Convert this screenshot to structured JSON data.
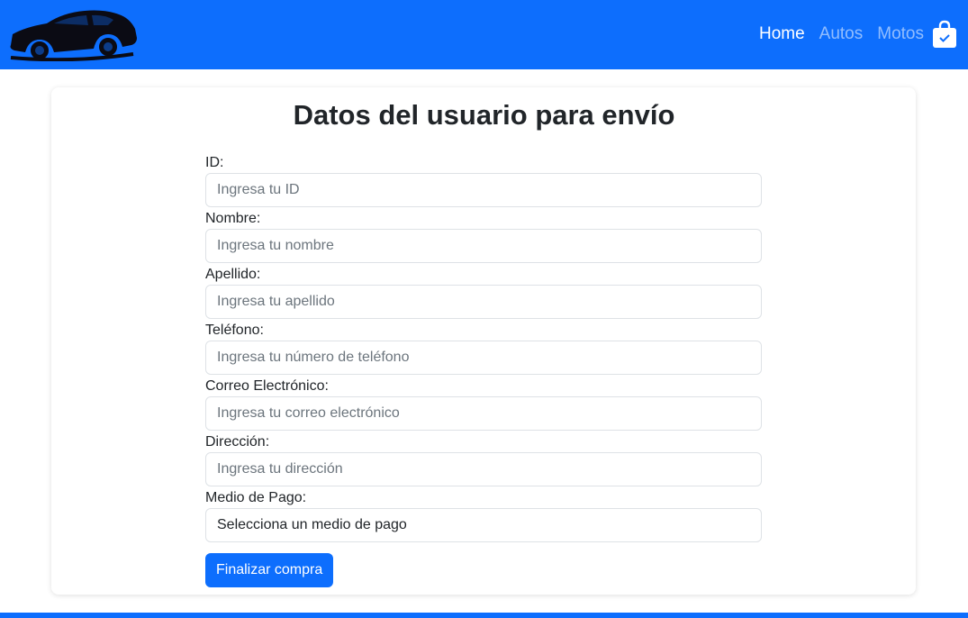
{
  "nav": {
    "logo_icon": "car-logo-icon",
    "links": [
      {
        "label": "Home",
        "active": true
      },
      {
        "label": "Autos",
        "active": false
      },
      {
        "label": "Motos",
        "active": false
      }
    ],
    "cart_icon": "shopping-bag-check-icon"
  },
  "form": {
    "title": "Datos del usuario para envío",
    "fields": [
      {
        "label": "ID:",
        "placeholder": "Ingresa tu ID"
      },
      {
        "label": "Nombre:",
        "placeholder": "Ingresa tu nombre"
      },
      {
        "label": "Apellido:",
        "placeholder": "Ingresa tu apellido"
      },
      {
        "label": "Teléfono:",
        "placeholder": "Ingresa tu número de teléfono"
      },
      {
        "label": "Correo Electrónico:",
        "placeholder": "Ingresa tu correo electrónico"
      },
      {
        "label": "Dirección:",
        "placeholder": "Ingresa tu dirección"
      }
    ],
    "payment": {
      "label": "Medio de Pago:",
      "selected": "Selecciona un medio de pago"
    },
    "submit_label": "Finalizar compra"
  },
  "colors": {
    "primary": "#0d6efd",
    "text": "#212529",
    "placeholder": "#6c757d",
    "border": "#dee2e6"
  }
}
